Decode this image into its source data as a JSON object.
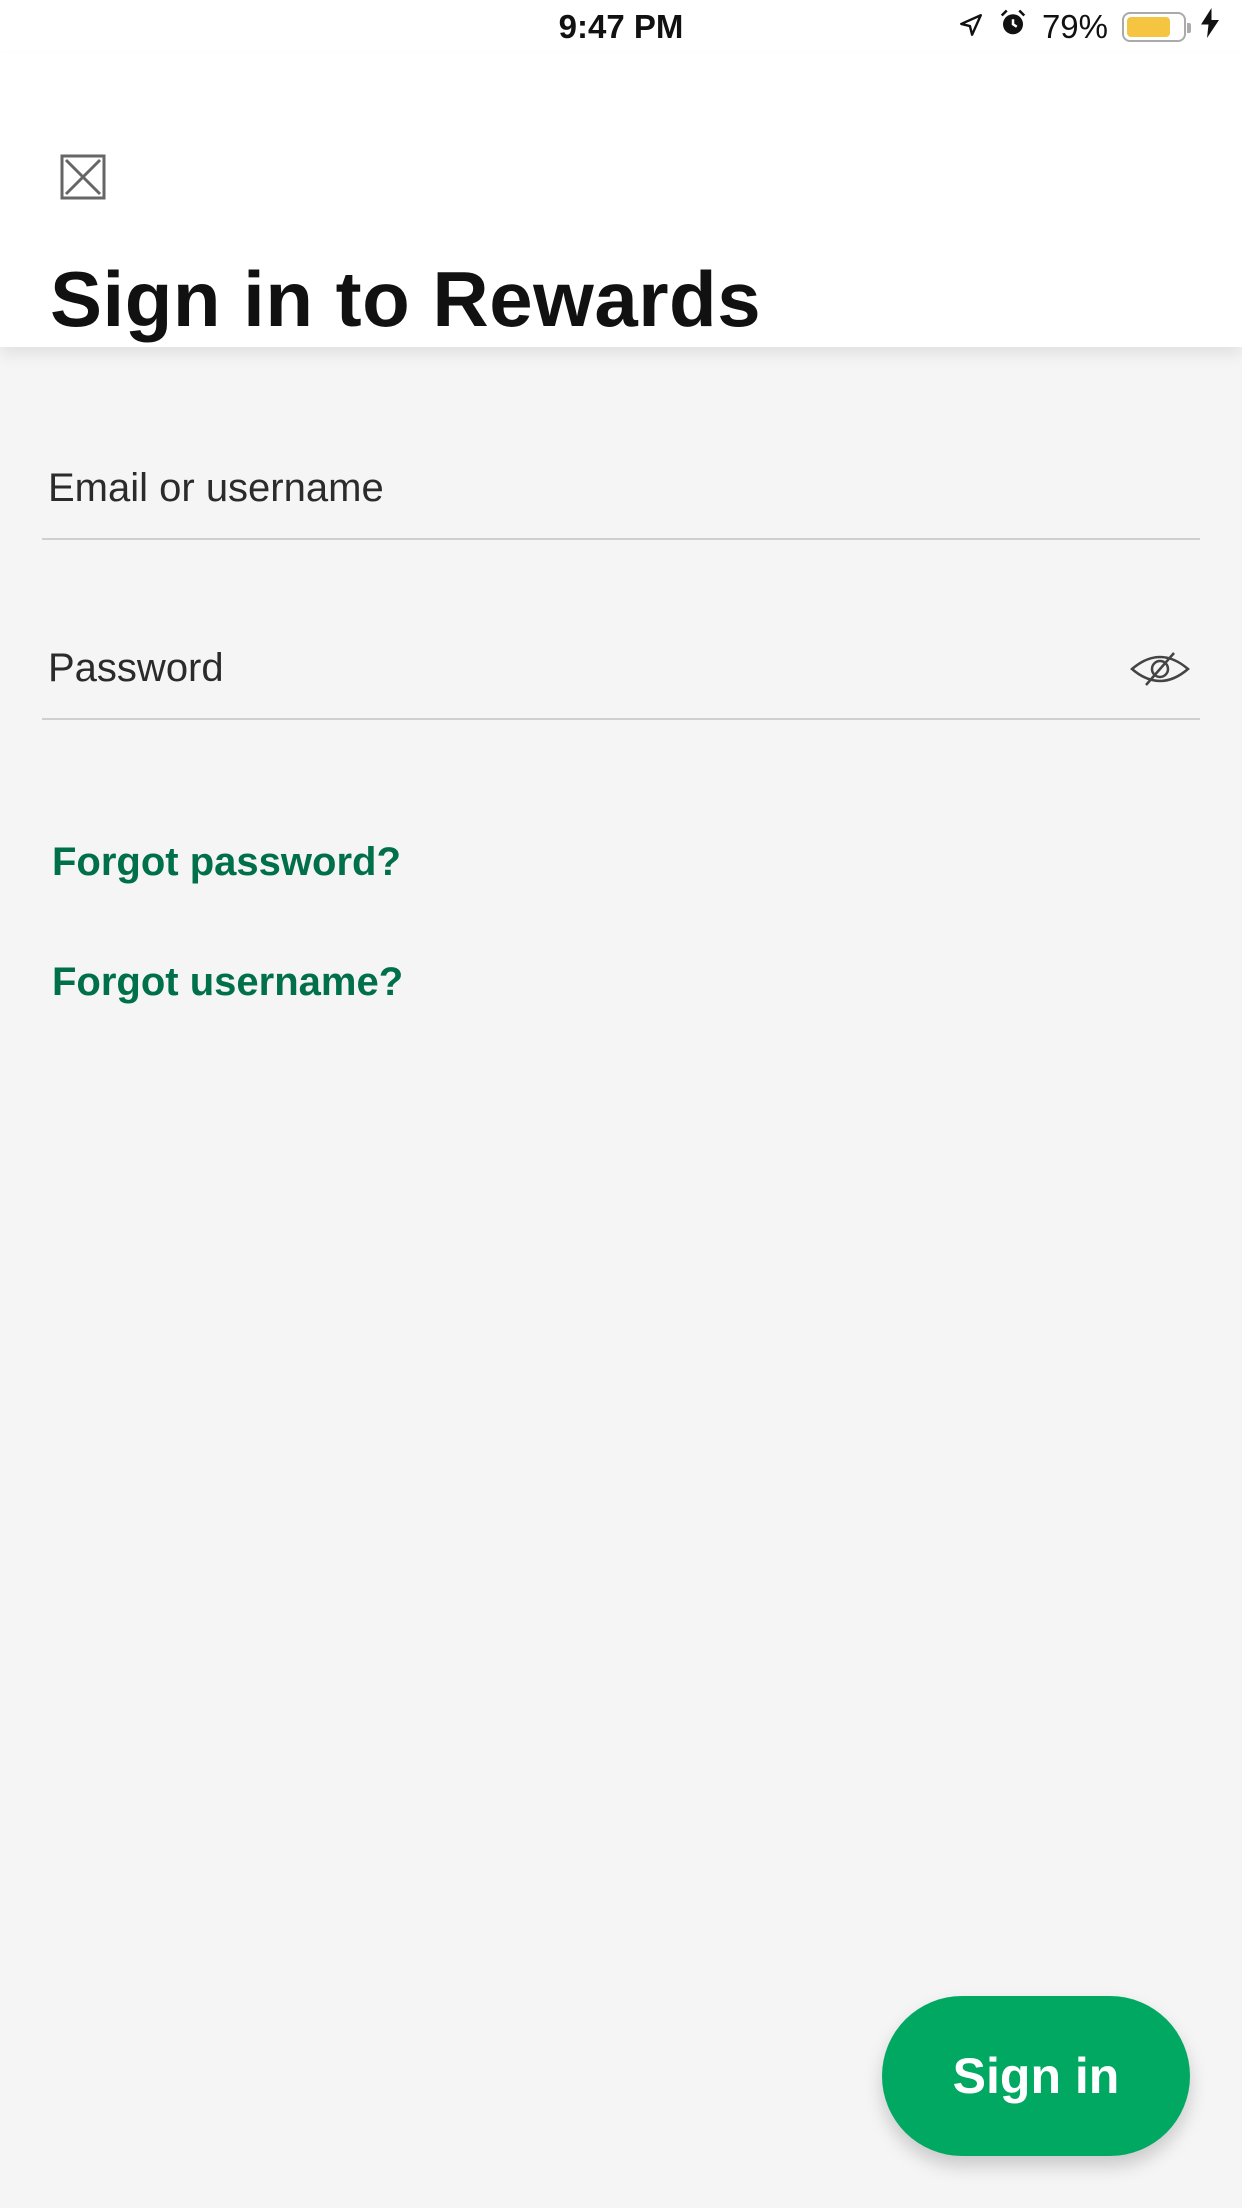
{
  "status_bar": {
    "time": "9:47 PM",
    "battery_percent": "79%",
    "battery_level": 0.79,
    "icons": [
      "location-icon",
      "alarm-icon",
      "battery-icon",
      "charging-icon"
    ]
  },
  "header": {
    "close_icon": "close-icon",
    "title": "Sign in to Rewards"
  },
  "form": {
    "email": {
      "label": "Email or username",
      "value": ""
    },
    "password": {
      "label": "Password",
      "value": "",
      "visibility_icon": "eye-hidden-icon"
    }
  },
  "links": {
    "forgot_password": "Forgot password?",
    "forgot_username": "Forgot username?"
  },
  "actions": {
    "sign_in_label": "Sign in"
  },
  "colors": {
    "accent_green": "#00a862",
    "link_green": "#00704a",
    "background": "#f5f5f5"
  }
}
